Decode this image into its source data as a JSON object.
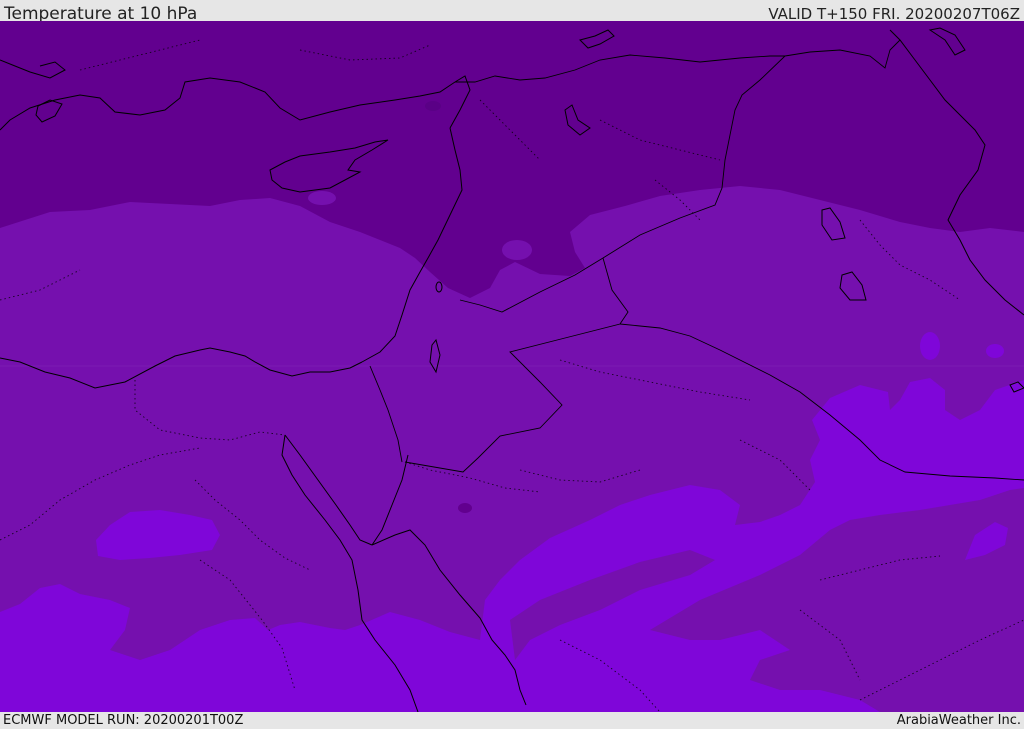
{
  "header": {
    "title": "Temperature at 10 hPa",
    "valid": "VALID T+150 FRI. 20200207T06Z"
  },
  "footer": {
    "model_run": "ECMWF MODEL RUN: 20200201T00Z",
    "credit": "ArabiaWeather Inc."
  },
  "colors": {
    "band_dark": "#62008f",
    "band_mid": "#7510ae",
    "band_light": "#7f06d9",
    "coast": "#000000",
    "bar": "#e6e6e6"
  }
}
